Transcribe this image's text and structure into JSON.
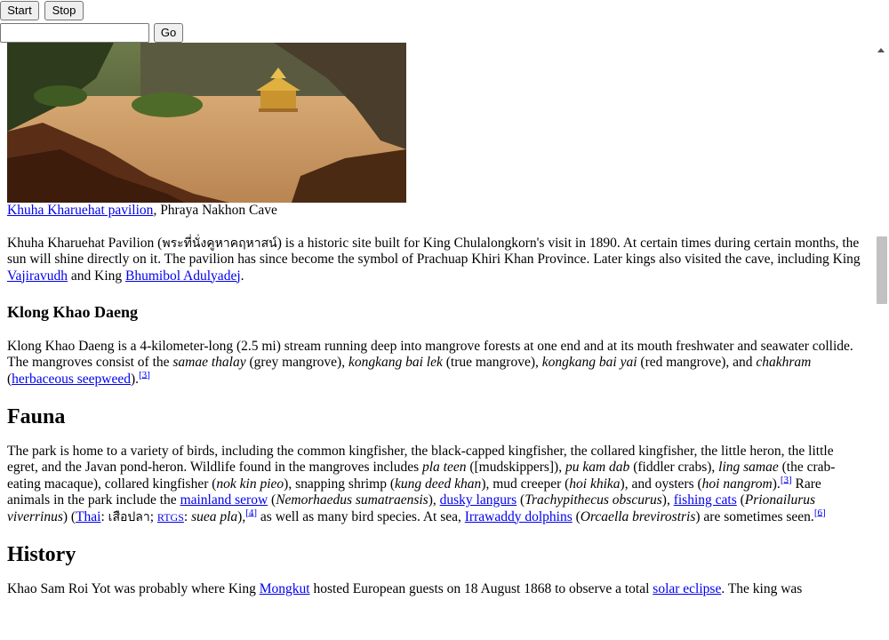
{
  "toolbar": {
    "start_label": "Start",
    "stop_label": "Stop",
    "go_label": "Go",
    "url_value": ""
  },
  "figure": {
    "caption_link": "Khuha Kharuehat pavilion",
    "caption_rest": ", Phraya Nakhon Cave"
  },
  "intro": {
    "t1": "Khuha Kharuehat Pavilion (",
    "thai": "พระที่นั่งคูหาคฤหาสน์",
    "t2": ") is a historic site built for King Chulalongkorn's visit in 1890. At certain times during certain months, the sun will shine directly on it. The pavilion has since become the symbol of Prachuap Khiri Khan Province. Later kings also visited the cave, including King ",
    "link1": "Vajiravudh",
    "t3": " and King ",
    "link2": "Bhumibol Adulyadej",
    "t4": "."
  },
  "klong": {
    "heading": "Klong Khao Daeng",
    "t1": "Klong Khao Daeng is a 4-kilometer-long (2.5 mi) stream running deep into mangrove forests at one end and at its mouth freshwater and seawater collide. The mangroves consist of the ",
    "i1": "samae thalay",
    "t2": " (grey mangrove), ",
    "i2": "kongkang bai lek",
    "t3": " (true mangrove), ",
    "i3": "kongkang bai yai",
    "t4": " (red mangrove), and ",
    "i4": "chakhram",
    "t5": " (",
    "link": "herbaceous seepweed",
    "t6": ").",
    "ref": "[3]"
  },
  "fauna": {
    "heading": "Fauna",
    "t1": "The park is home to a variety of birds, including the common kingfisher, the black-capped kingfisher, the collared kingfisher, the little heron, the little egret, and the Javan pond-heron. Wildlife found in the mangroves includes ",
    "i1": "pla teen",
    "t2": " ([mudskippers]), ",
    "i2": "pu kam dab",
    "t3": " (fiddler crabs), ",
    "i3": "ling samae",
    "t4": " (the crab-eating macaque), collared kingfisher (",
    "i4": "nok kin pieo",
    "t5": "), snapping shrimp (",
    "i5": "kung deed khan",
    "t6": "), mud creeper (",
    "i6": "hoi khika",
    "t7": "), and oysters (",
    "i7": "hoi nangrom",
    "t8": ").",
    "ref1": "[3]",
    "t9": " Rare animals in the park include the ",
    "link1": "mainland serow",
    "t10": " (",
    "i8": "Nemorhaedus sumatraensis",
    "t11": "), ",
    "link2": "dusky langurs",
    "t12": " (",
    "i9": "Trachypithecus obscurus",
    "t13": "), ",
    "link3": "fishing cats",
    "t14": " (",
    "i10": "Prionailurus viverrinus",
    "t15": ") (",
    "link4": "Thai",
    "t16": ": ",
    "thai": "เสือปลา",
    "t17": "; ",
    "link5": "RTGS",
    "t18": ": ",
    "i11": "suea pla",
    "t19": "),",
    "ref2": "[4]",
    "t20": " as well as many bird species. At sea, ",
    "link6": "Irrawaddy dolphins",
    "t21": " (",
    "i12": "Orcaella brevirostris",
    "t22": ") are sometimes seen.",
    "ref3": "[6]"
  },
  "history": {
    "heading": "History",
    "t1": "Khao Sam Roi Yot was probably where King ",
    "link1": "Mongkut",
    "t2": " hosted European guests on 18 August 1868 to observe a total ",
    "link2": "solar eclipse",
    "t3": ". The king was"
  }
}
